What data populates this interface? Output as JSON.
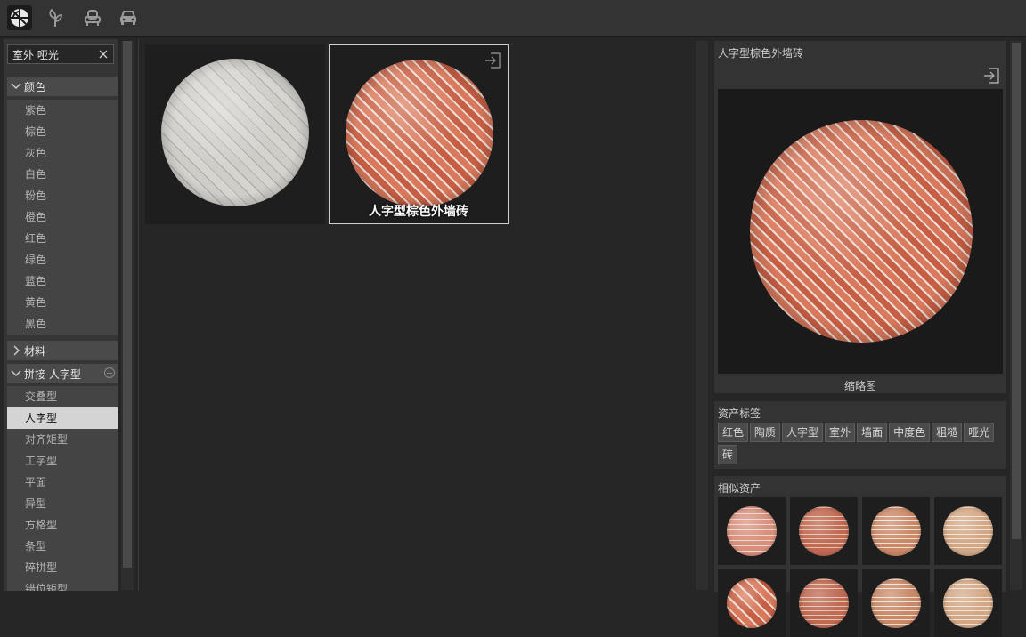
{
  "toolbar": {
    "tools": [
      {
        "icon": "material-icon",
        "active": true
      },
      {
        "icon": "plant-icon",
        "active": false
      },
      {
        "icon": "armchair-icon",
        "active": false
      },
      {
        "icon": "car-icon",
        "active": false
      }
    ]
  },
  "search": {
    "value": "室外 哑光"
  },
  "filters": {
    "color": {
      "label": "颜色",
      "expanded": true,
      "items": [
        "紫色",
        "棕色",
        "灰色",
        "白色",
        "粉色",
        "橙色",
        "红色",
        "绿色",
        "蓝色",
        "黄色",
        "黑色"
      ]
    },
    "material": {
      "label": "材料",
      "expanded": false
    },
    "pattern": {
      "label": "拼接 人字型",
      "expanded": true,
      "selected": "人字型",
      "items": [
        "交叠型",
        "人字型",
        "对齐矩型",
        "工字型",
        "平面",
        "异型",
        "方格型",
        "条型",
        "碎拼型",
        "错位矩型"
      ]
    }
  },
  "results": [
    {
      "name": "",
      "style": "gray-herringbone",
      "selected": false
    },
    {
      "name": "人字型棕色外墙砖",
      "style": "red-herringbone",
      "selected": true
    }
  ],
  "detail": {
    "title": "人字型棕色外墙砖",
    "thumbnail_label": "缩略图",
    "tags_title": "资产标签",
    "tags": [
      "红色",
      "陶质",
      "人字型",
      "室外",
      "墙面",
      "中度色",
      "粗糙",
      "哑光",
      "砖"
    ],
    "similar_title": "相似资产",
    "similar": [
      "brick1",
      "brick2",
      "brick3",
      "brick4",
      "red-herringbone",
      "brick2",
      "brick3",
      "brick4"
    ]
  },
  "colors": {
    "accent_selected": "#d4d4d4",
    "panel": "#333333",
    "background": "#262626"
  }
}
